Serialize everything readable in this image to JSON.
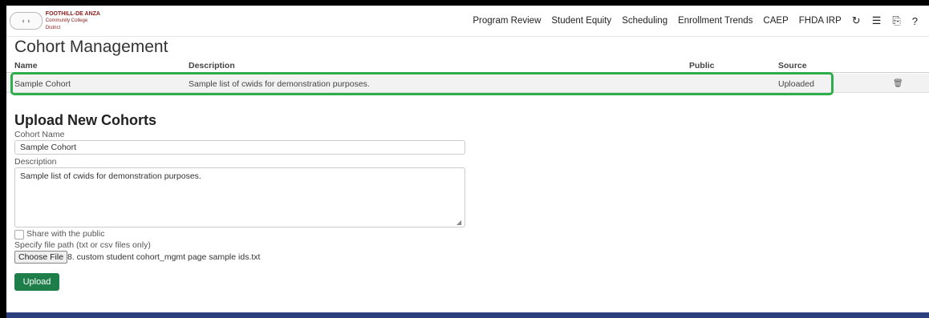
{
  "nav": {
    "logo": {
      "line1": "FOOTHILL-DE ANZA",
      "line2": "Community College District"
    },
    "links": [
      "Program Review",
      "Student Equity",
      "Scheduling",
      "Enrollment Trends",
      "CAEP",
      "FHDA IRP"
    ],
    "icons": {
      "refresh": "↻",
      "menu": "☰",
      "print": "⎘",
      "help": "?"
    }
  },
  "page_title": "Cohort Management",
  "table": {
    "headers": [
      "Name",
      "Description",
      "Public",
      "Source"
    ],
    "rows": [
      {
        "name": "Sample Cohort",
        "description": "Sample list of cwids for demonstration purposes.",
        "public": "",
        "source": "Uploaded"
      }
    ],
    "delete_icon": "🗑"
  },
  "upload": {
    "heading": "Upload New Cohorts",
    "name_label": "Cohort Name",
    "name_value": "Sample Cohort",
    "desc_label": "Description",
    "desc_value": "Sample list of cwids for demonstration purposes.",
    "share_label": "Share with the public",
    "file_label": "Specify file path (txt or csv files only)",
    "file_button": "Choose File",
    "file_name": "8. custom student cohort_mgmt page sample ids.txt",
    "submit_label": "Upload"
  },
  "colors": {
    "highlight": "#2eae4a",
    "upload_button": "#1e7e4a",
    "footer": "#2b3f7e"
  }
}
